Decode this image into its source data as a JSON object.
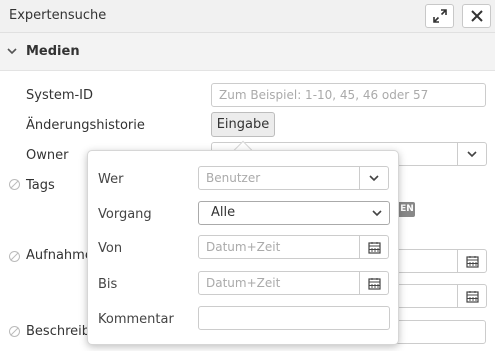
{
  "window": {
    "title": "Expertensuche"
  },
  "section": {
    "title": "Medien"
  },
  "fields": {
    "system_id_label": "System-ID",
    "system_id_placeholder": "Zum Beispiel: 1-10, 45, 46 oder 57",
    "history_label": "Änderungshistorie",
    "history_button": "Eingabe",
    "owner_label": "Owner",
    "tags_label": "Tags",
    "tags_badge": "EN",
    "aufnahme_label": "Aufnahmedatum",
    "beschreibung_label": "Beschreibung"
  },
  "popover": {
    "wer_label": "Wer",
    "wer_placeholder": "Benutzer",
    "vorgang_label": "Vorgang",
    "vorgang_value": "Alle",
    "von_label": "Von",
    "von_placeholder": "Datum+Zeit",
    "bis_label": "Bis",
    "bis_placeholder": "Datum+Zeit",
    "kommentar_label": "Kommentar",
    "kommentar_value": ""
  }
}
